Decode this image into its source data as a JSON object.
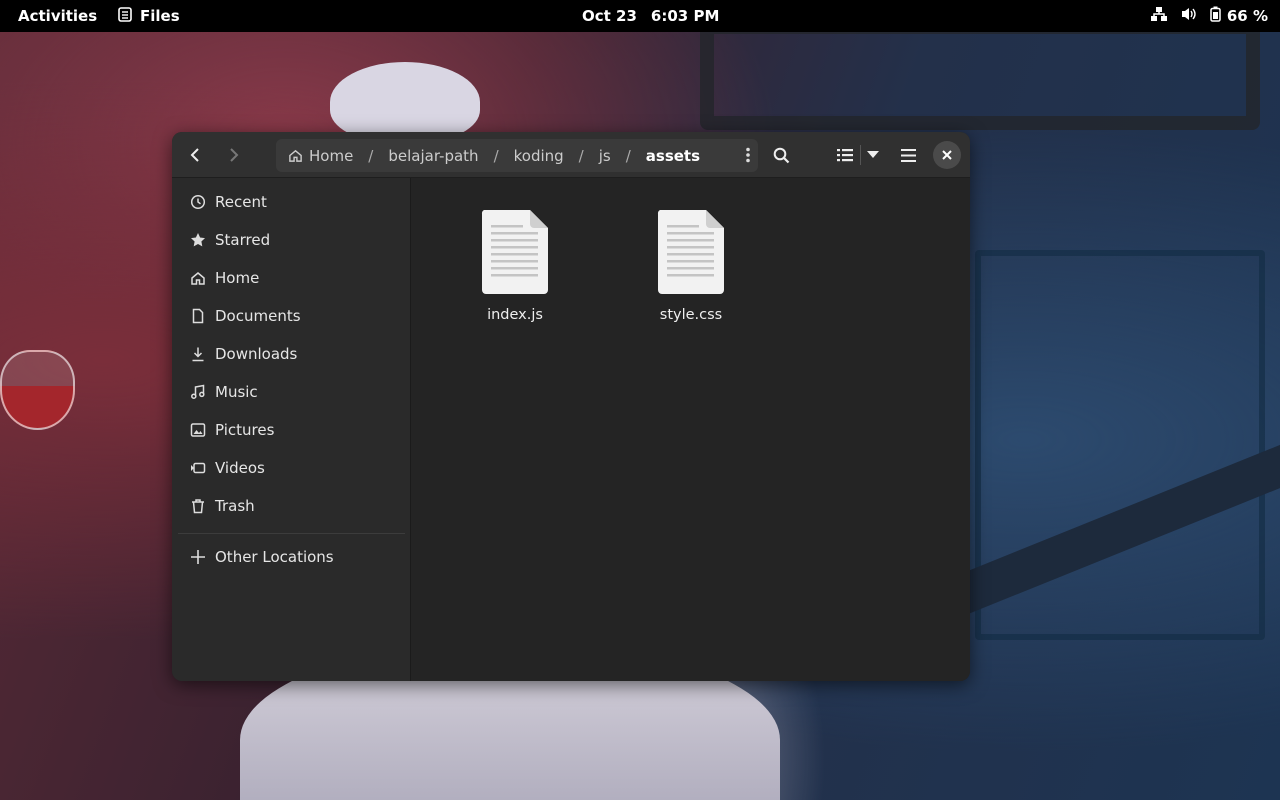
{
  "topbar": {
    "activities": "Activities",
    "app_name": "Files",
    "date": "Oct 23",
    "time": "6:03 PM",
    "battery": "66 %"
  },
  "pathbar": {
    "crumbs": [
      "Home",
      "belajar-path",
      "koding",
      "js",
      "assets"
    ],
    "separator": "/"
  },
  "sidebar": {
    "items": [
      {
        "label": "Recent",
        "icon": "clock-icon"
      },
      {
        "label": "Starred",
        "icon": "star-icon"
      },
      {
        "label": "Home",
        "icon": "home-icon"
      },
      {
        "label": "Documents",
        "icon": "document-icon"
      },
      {
        "label": "Downloads",
        "icon": "download-icon"
      },
      {
        "label": "Music",
        "icon": "music-icon"
      },
      {
        "label": "Pictures",
        "icon": "picture-icon"
      },
      {
        "label": "Videos",
        "icon": "video-icon"
      },
      {
        "label": "Trash",
        "icon": "trash-icon"
      }
    ],
    "other_locations": "Other Locations"
  },
  "files": [
    {
      "name": "index.js",
      "icon": "text-file-icon"
    },
    {
      "name": "style.css",
      "icon": "text-file-icon"
    }
  ]
}
